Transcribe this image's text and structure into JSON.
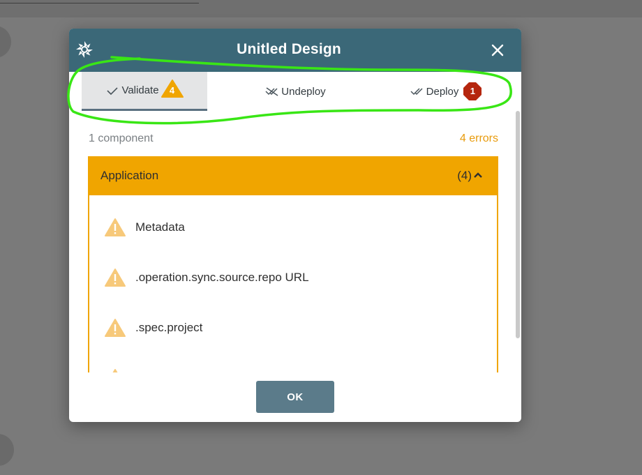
{
  "modal": {
    "title": "Unitled Design",
    "close_icon": "close-icon",
    "logo_icon": "meshery-logo-icon"
  },
  "tabs": [
    {
      "label": "Validate",
      "icon": "check-icon",
      "badge": "4",
      "badge_shape": "triangle",
      "badge_color": "#f0a500",
      "active": true
    },
    {
      "label": "Undeploy",
      "icon": "double-check-strike-icon",
      "active": false
    },
    {
      "label": "Deploy",
      "icon": "double-check-icon",
      "badge": "1",
      "badge_shape": "octagon",
      "badge_color": "#b5260e",
      "active": false
    }
  ],
  "summary": {
    "components": "1 component",
    "errors": "4 errors"
  },
  "group": {
    "title": "Application",
    "count": "(4)",
    "expanded": true,
    "color": "#f0a500",
    "issues": [
      {
        "text": "Metadata",
        "icon": "warning-icon"
      },
      {
        "text": ".operation.sync.source.repo URL",
        "icon": "warning-icon"
      },
      {
        "text": ".spec.project",
        "icon": "warning-icon"
      }
    ]
  },
  "ok_button": "OK",
  "colors": {
    "header": "#3b6878",
    "warning": "#f0a500",
    "error": "#b5260e",
    "highlight": "#39e615"
  }
}
